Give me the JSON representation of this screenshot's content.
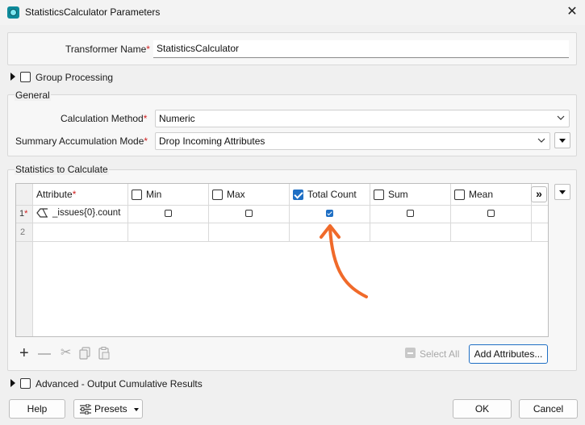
{
  "window": {
    "title": "StatisticsCalculator Parameters"
  },
  "transformer": {
    "label": "Transformer Name",
    "value": "StatisticsCalculator"
  },
  "group_processing": {
    "label": "Group Processing",
    "checked": false
  },
  "general": {
    "legend": "General",
    "calc_method_label": "Calculation Method",
    "calc_method_value": "Numeric",
    "summary_mode_label": "Summary Accumulation Mode",
    "summary_mode_value": "Drop Incoming Attributes"
  },
  "stats": {
    "legend": "Statistics to Calculate",
    "columns": [
      {
        "label": "Attribute"
      },
      {
        "label": "Min",
        "checked": false
      },
      {
        "label": "Max",
        "checked": false
      },
      {
        "label": "Total Count",
        "checked": true
      },
      {
        "label": "Sum",
        "checked": false
      },
      {
        "label": "Mean",
        "checked": false
      }
    ],
    "more_columns": "»",
    "rows": [
      {
        "num": "1",
        "attribute": "_issues{0}.count",
        "min": false,
        "max": false,
        "total_count": true,
        "sum": false,
        "mean": false
      },
      {
        "num": "2",
        "attribute": ""
      }
    ],
    "select_all_label": "Select All",
    "add_attributes_label": "Add Attributes..."
  },
  "advanced": {
    "label": "Advanced - Output Cumulative Results",
    "checked": false
  },
  "footer": {
    "help_label": "Help",
    "presets_label": "Presets",
    "ok_label": "OK",
    "cancel_label": "Cancel"
  },
  "colors": {
    "annotation_arrow": "#f06a2a",
    "accent": "#1f6fc4",
    "required": "#d02020"
  },
  "icons": [
    "app-icon",
    "close-icon",
    "expand-triangle-icon",
    "chevron-down-icon",
    "attribute-icon",
    "plus-icon",
    "minus-icon",
    "cut-icon",
    "copy-icon",
    "paste-icon",
    "presets-icon",
    "annotation-arrow-icon"
  ]
}
